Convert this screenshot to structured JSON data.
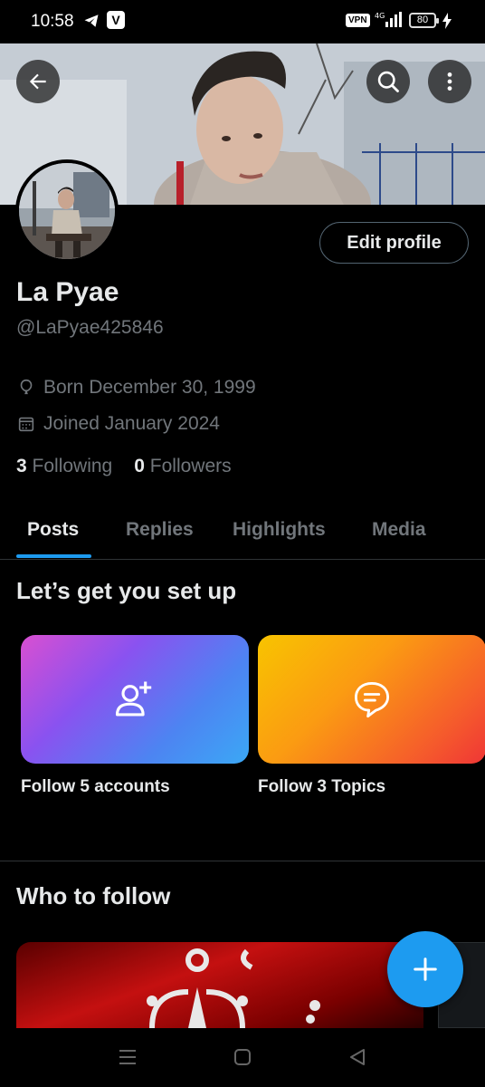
{
  "status_bar": {
    "time": "10:58",
    "app_badge": "V",
    "vpn": "VPN",
    "network": "4G",
    "battery": "80"
  },
  "profile": {
    "name": "La Pyae",
    "handle": "@LaPyae425846",
    "born": "Born December 30, 1999",
    "joined": "Joined January 2024",
    "following_count": "3",
    "following_label": "Following",
    "followers_count": "0",
    "followers_label": "Followers",
    "edit_label": "Edit profile"
  },
  "tabs": [
    {
      "label": "Posts",
      "active": true
    },
    {
      "label": "Replies",
      "active": false
    },
    {
      "label": "Highlights",
      "active": false
    },
    {
      "label": "Media",
      "active": false
    }
  ],
  "setup": {
    "title": "Let’s get you set up",
    "cards": [
      {
        "label": "Follow 5 accounts",
        "icon": "add-user-icon"
      },
      {
        "label": "Follow 3 Topics",
        "icon": "chat-bubble-icon"
      }
    ]
  },
  "who_to_follow": {
    "title": "Who to follow"
  },
  "colors": {
    "accent": "#1d9bf0",
    "background": "#000000",
    "secondary_text": "#71767b"
  }
}
